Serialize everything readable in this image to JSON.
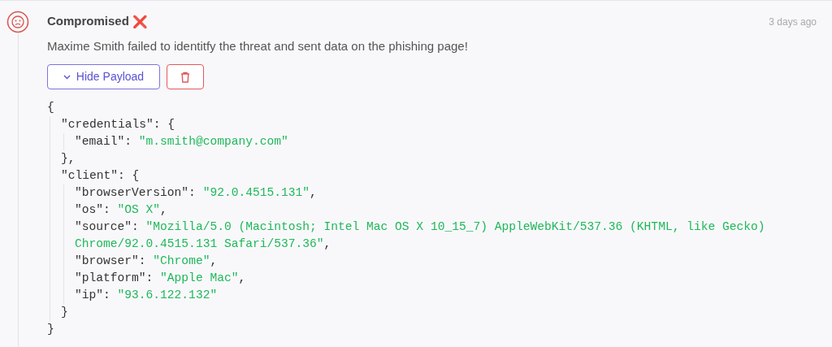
{
  "event": {
    "title": "Compromised",
    "status_mark": "❌",
    "time": "3 days ago",
    "description": "Maxime Smith failed to identitfy the threat and sent data on the phishing page!",
    "payload_button": {
      "label": "Hide Payload",
      "expanded": true
    },
    "payload": {
      "open": "{",
      "close": "}",
      "children": [
        {
          "key": "\"credentials\":",
          "open": "{",
          "close": "},",
          "children": [
            {
              "key": "\"email\":",
              "value": "\"m.smith@company.com\""
            }
          ]
        },
        {
          "key": "\"client\":",
          "open": "{",
          "close": "}",
          "children": [
            {
              "key": "\"browserVersion\":",
              "value": "\"92.0.4515.131\"",
              "comma": ","
            },
            {
              "key": "\"os\":",
              "value": "\"OS X\"",
              "comma": ","
            },
            {
              "key": "\"source\":",
              "value": "\"Mozilla/5.0 (Macintosh; Intel Mac OS X 10_15_7) AppleWebKit/537.36 (KHTML, like Gecko) Chrome/92.0.4515.131 Safari/537.36\"",
              "comma": ","
            },
            {
              "key": "\"browser\":",
              "value": "\"Chrome\"",
              "comma": ","
            },
            {
              "key": "\"platform\":",
              "value": "\"Apple Mac\"",
              "comma": ","
            },
            {
              "key": "\"ip\":",
              "value": "\"93.6.122.132\""
            }
          ]
        }
      ]
    }
  }
}
